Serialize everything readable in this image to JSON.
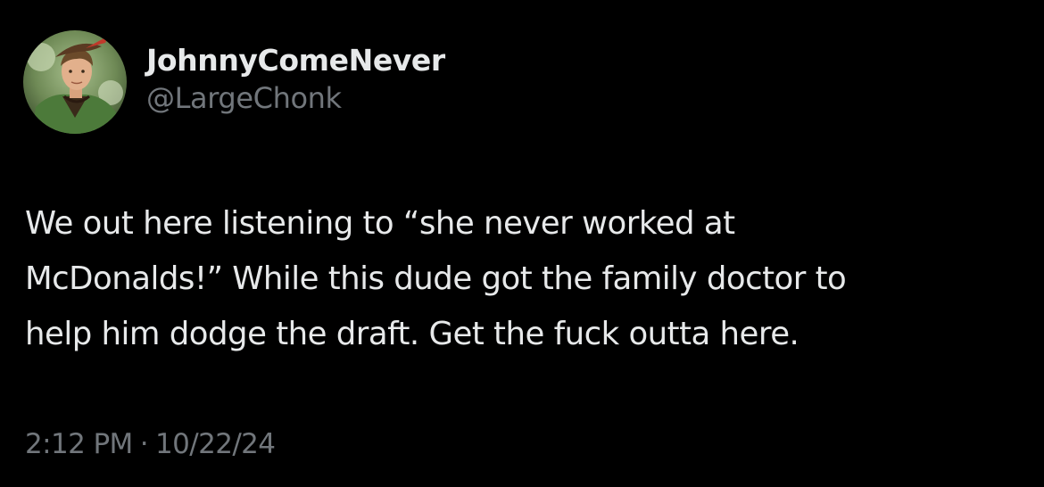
{
  "tweet": {
    "author": {
      "display_name": "JohnnyComeNever",
      "handle": "@LargeChonk",
      "avatar_icon": "avatar-photo"
    },
    "text_lines": [
      "We out here listening to “she never worked at",
      "McDonalds!” While this dude got the family doctor to",
      "help him dodge the draft. Get the fuck outta here."
    ],
    "time": "2:12 PM",
    "separator": "·",
    "date": "10/22/24"
  },
  "colors": {
    "background": "#000000",
    "primary_text": "#e7e9ea",
    "secondary_text": "#71767b"
  }
}
